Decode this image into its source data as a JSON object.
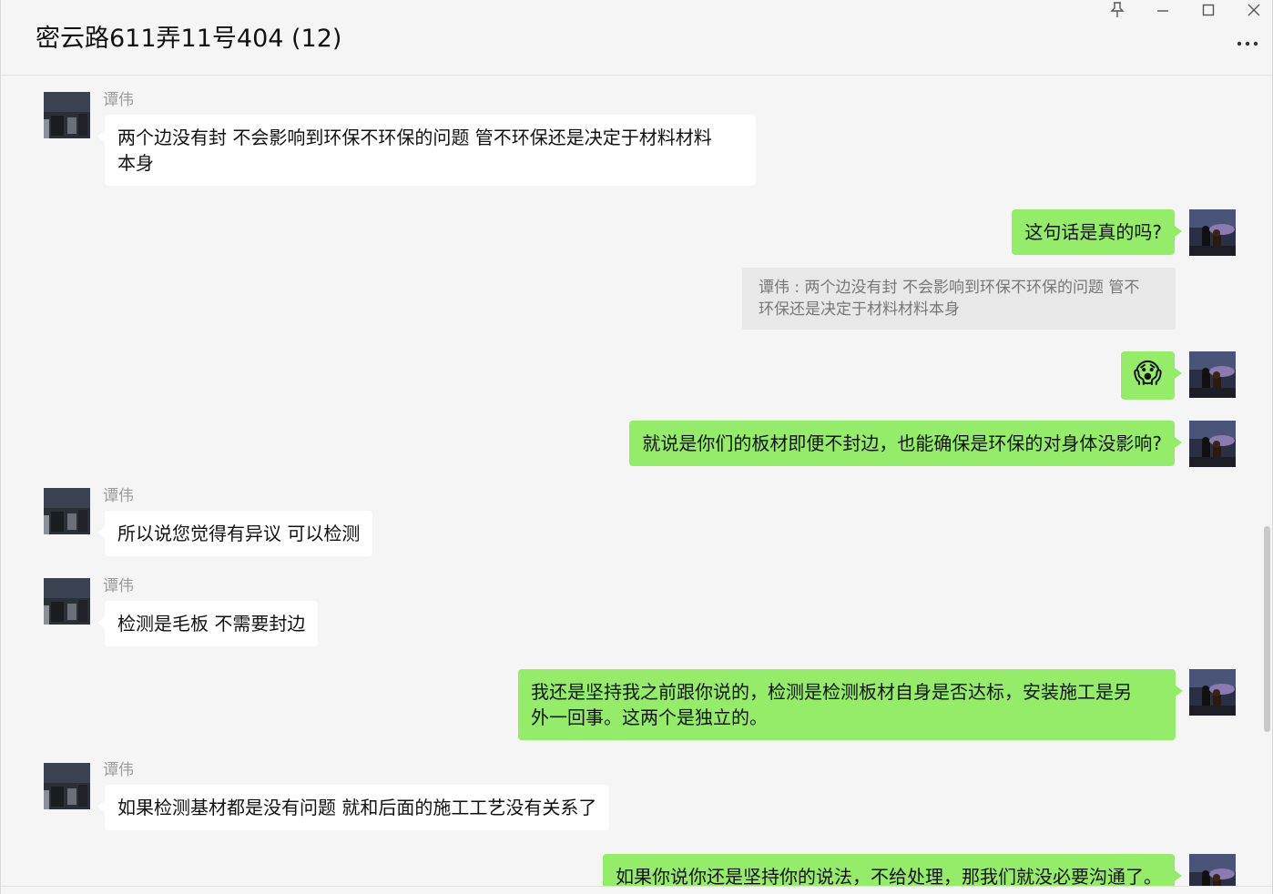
{
  "window": {
    "title": "密云路611弄11号404 (12)",
    "controls": [
      "pin-icon",
      "minimize-icon",
      "maximize-icon",
      "close-icon"
    ],
    "more_icon": "more-icon"
  },
  "colors": {
    "background": "#f5f5f5",
    "incoming_bubble": "#ffffff",
    "outgoing_bubble": "#95ec69",
    "quote_bg": "#e8e8e8",
    "sender_name": "#9b9b9b"
  },
  "messages": [
    {
      "direction": "in",
      "sender": "谭伟",
      "text": "两个边没有封 不会影响到环保不环保的问题 管不环保还是决定于材料材料本身",
      "text_line1": "两个边没有封 不会影响到环保不环保的问题 管不环保还是决定于材料材料",
      "text_line2": "本身"
    },
    {
      "direction": "out",
      "text": "这句话是真的吗?",
      "quote": "谭伟 : 两个边没有封 不会影响到环保不环保的问题 管不环保还是决定于材料材料本身",
      "quote_line1": "谭伟 : 两个边没有封 不会影响到环保不环保的问题 管不",
      "quote_line2": "环保还是决定于材料材料本身"
    },
    {
      "direction": "out",
      "text": "😱"
    },
    {
      "direction": "out",
      "text": "就说是你们的板材即便不封边，也能确保是环保的对身体没影响?"
    },
    {
      "direction": "in",
      "sender": "谭伟",
      "text": "所以说您觉得有异议 可以检测"
    },
    {
      "direction": "in",
      "sender": "谭伟",
      "text": "检测是毛板 不需要封边"
    },
    {
      "direction": "out",
      "text": "我还是坚持我之前跟你说的，检测是检测板材自身是否达标，安装施工是另外一回事。这两个是独立的。",
      "text_line1": "我还是坚持我之前跟你说的，检测是检测板材自身是否达标，安装施工是另",
      "text_line2": "外一回事。这两个是独立的。"
    },
    {
      "direction": "in",
      "sender": "谭伟",
      "text": "如果检测基材都是没有问题 就和后面的施工工艺没有关系了"
    },
    {
      "direction": "out",
      "text": "如果你说你还是坚持你的说法，不给处理，那我们就没必要沟通了。"
    }
  ]
}
